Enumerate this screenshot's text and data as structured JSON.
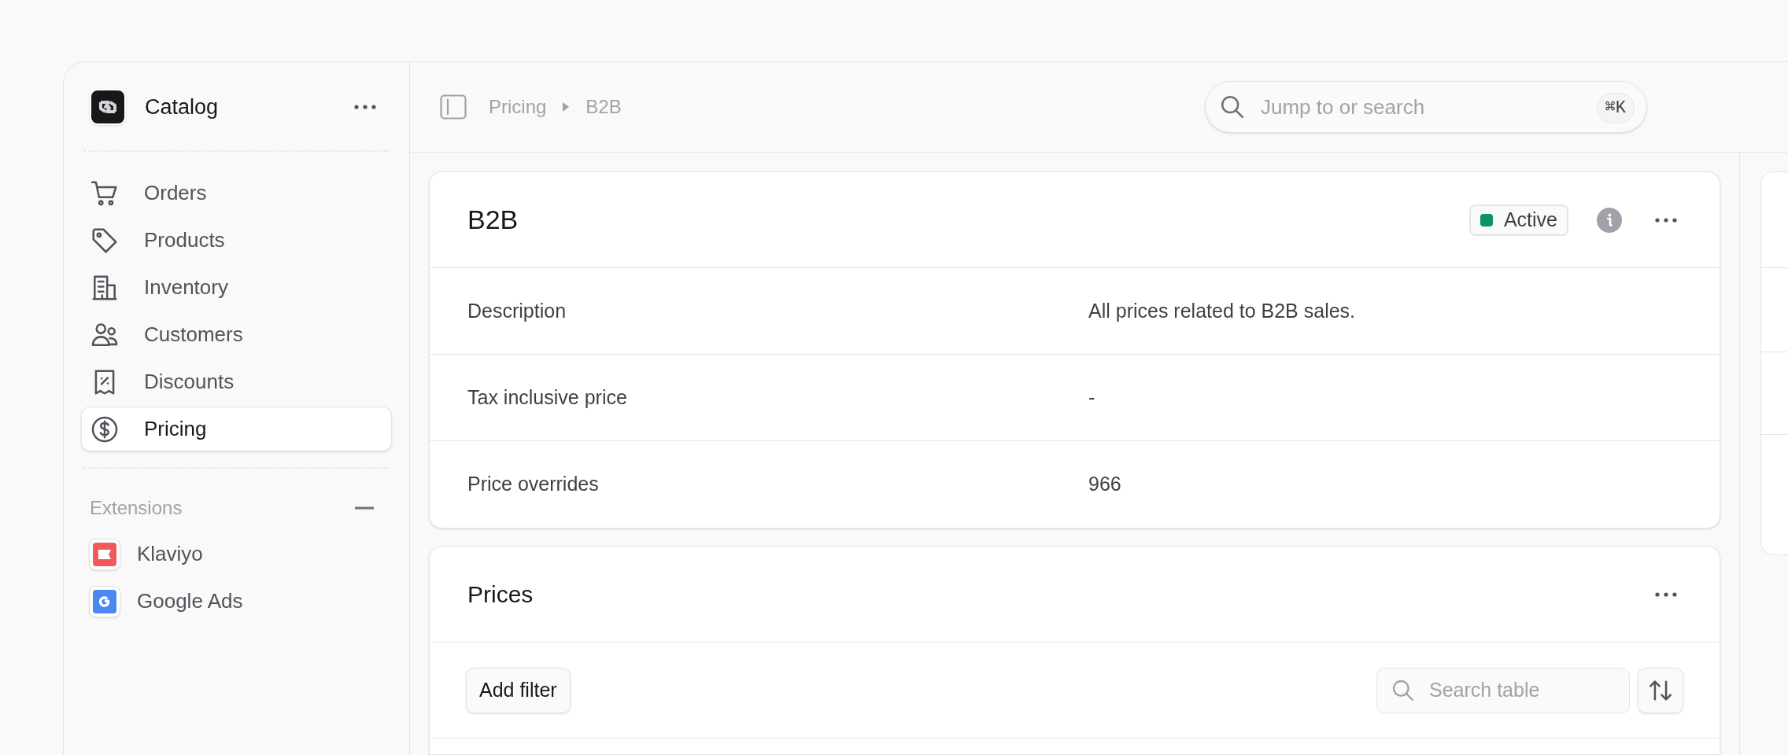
{
  "sidebar": {
    "title": "Catalog",
    "items": [
      {
        "label": "Orders",
        "selected": false
      },
      {
        "label": "Products",
        "selected": false
      },
      {
        "label": "Inventory",
        "selected": false
      },
      {
        "label": "Customers",
        "selected": false
      },
      {
        "label": "Discounts",
        "selected": false
      },
      {
        "label": "Pricing",
        "selected": true
      }
    ],
    "extensions": {
      "title": "Extensions",
      "expanded": true,
      "items": [
        {
          "label": "Klaviyo",
          "color": "#f05a5a"
        },
        {
          "label": "Google Ads",
          "color": "#4c86f0"
        }
      ]
    }
  },
  "breadcrumbs": [
    "Pricing",
    "B2B"
  ],
  "search": {
    "placeholder": "Jump to or search",
    "shortcut": "⌘K"
  },
  "price_list": {
    "title": "B2B",
    "status": {
      "label": "Active",
      "color": "#0c9467"
    },
    "fields": [
      {
        "label": "Description",
        "value": "All prices related to B2B sales."
      },
      {
        "label": "Tax inclusive price",
        "value": "-"
      },
      {
        "label": "Price overrides",
        "value": "966"
      }
    ]
  },
  "prices": {
    "title": "Prices",
    "filter_button": "Add filter",
    "search": {
      "placeholder": "Search table"
    }
  }
}
